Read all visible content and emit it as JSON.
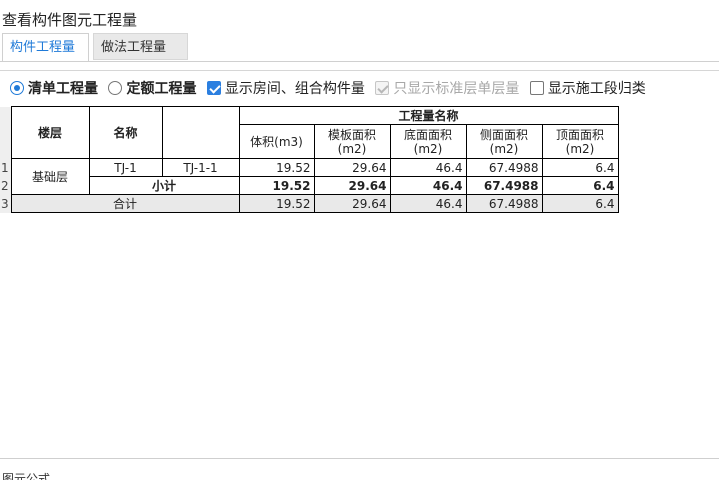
{
  "window": {
    "title": "查看构件图元工程量"
  },
  "tabs": [
    {
      "label": "构件工程量",
      "active": true
    },
    {
      "label": "做法工程量",
      "active": false
    }
  ],
  "options": {
    "list_qty": {
      "label": "清单工程量",
      "selected": true
    },
    "quota_qty": {
      "label": "定额工程量",
      "selected": false
    },
    "show_rooms": {
      "label": "显示房间、组合构件量",
      "checked": true
    },
    "std_floor": {
      "label": "只显示标准层单层量",
      "checked": true,
      "disabled": true
    },
    "construction": {
      "label": "显示施工段归类",
      "checked": false
    }
  },
  "table": {
    "headers": {
      "floor": "楼层",
      "name": "名称",
      "blank": "",
      "group": "工程量名称",
      "columns": [
        "体积(m3)",
        "模板面积(m2)",
        "底面面积(m2)",
        "侧面面积(m2)",
        "顶面面积(m2)"
      ]
    },
    "rows": [
      {
        "num": "1",
        "floor": "基础层",
        "name": "TJ-1",
        "sub": "TJ-1-1",
        "values": [
          "19.52",
          "29.64",
          "46.4",
          "67.4988",
          "6.4"
        ]
      },
      {
        "num": "2",
        "label": "小计",
        "values": [
          "19.52",
          "29.64",
          "46.4",
          "67.4988",
          "6.4"
        ]
      },
      {
        "num": "3",
        "label": "合计",
        "values": [
          "19.52",
          "29.64",
          "46.4",
          "67.4988",
          "6.4"
        ]
      }
    ]
  },
  "bottom": {
    "text": "图元公式"
  }
}
